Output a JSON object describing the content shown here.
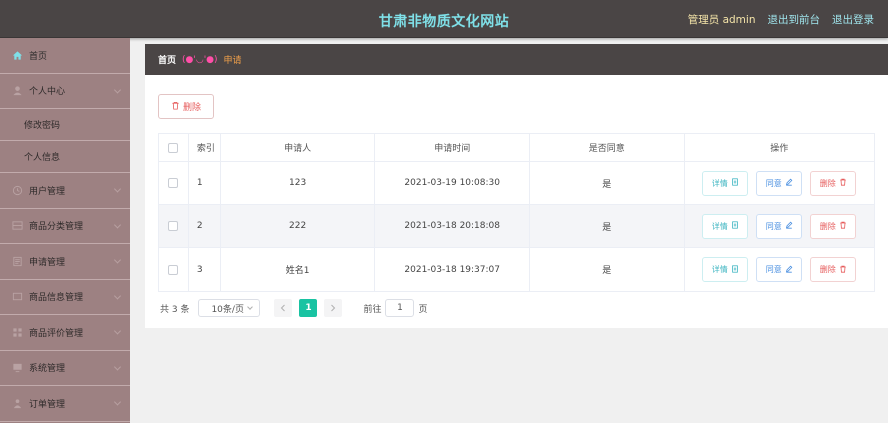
{
  "header": {
    "title": "甘肃非物质文化网站",
    "admin_label": "管理员 admin",
    "front_link": "退出到前台",
    "logout_link": "退出登录"
  },
  "sidebar": {
    "home": "首页",
    "personal_center": "个人中心",
    "change_password": "修改密码",
    "personal_info": "个人信息",
    "items": [
      "用户管理",
      "商品分类管理",
      "申请管理",
      "商品信息管理",
      "商品评价管理",
      "系统管理",
      "订单管理"
    ]
  },
  "breadcrumb": {
    "home": "首页",
    "face": "(●'◡'●)",
    "current": "申请"
  },
  "toolbar": {
    "delete_label": "删除"
  },
  "table": {
    "headers": [
      "索引",
      "申请人",
      "申请时间",
      "是否同意",
      "操作"
    ],
    "rows": [
      {
        "index": "1",
        "applicant": "123",
        "time": "2021-03-19 10:08:30",
        "agreed": "是"
      },
      {
        "index": "2",
        "applicant": "222",
        "time": "2021-03-18 20:18:08",
        "agreed": "是"
      },
      {
        "index": "3",
        "applicant": "姓名1",
        "time": "2021-03-18 19:37:07",
        "agreed": "是"
      }
    ],
    "actions": {
      "detail": "详情",
      "agree": "同意",
      "delete": "删除"
    }
  },
  "pagination": {
    "total": "共 3 条",
    "page_size": "10条/页",
    "current_page": "1",
    "goto_label": "前往",
    "goto_value": "1",
    "page_suffix": "页"
  },
  "colors": {
    "topbar": "#4a4545",
    "title": "#7fe0e8",
    "sidebar": "#9d8182",
    "accent_page": "#19c3a2",
    "danger": "#e65b5b"
  }
}
